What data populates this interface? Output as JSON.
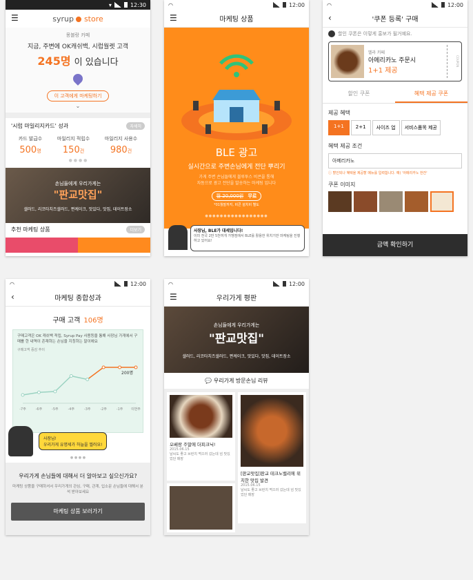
{
  "status": {
    "time": "12:30",
    "time2": "12:00"
  },
  "p1": {
    "logo_syrup": "syrup",
    "logo_store": "store",
    "cafe_name": "몽블랑 카페",
    "hero_line1": "지금, 주변에 OK캐쉬백, 시럽월렛 고객",
    "hero_count": "245명",
    "hero_suffix": "이 있습니다",
    "locate_button": "이 고객에게 마케팅하기",
    "card_title": "'시럽 마일리지카드' 성과",
    "card_badge": "자세히",
    "stats": [
      {
        "label": "카드 발급수",
        "value": "500",
        "unit": "명"
      },
      {
        "label": "마일리지 적립수",
        "value": "150",
        "unit": "건"
      },
      {
        "label": "마일리지 사용수",
        "value": "980",
        "unit": "건"
      }
    ],
    "banner_small": "손님들에게 우리가게는",
    "banner_big": "\"판교맛집\"",
    "banner_tags": "샐러드, 리코타치즈샐러드, 편케이크, 맛있다, 맛집, 데이트장소",
    "rec_title": "추천 마케팅 상품",
    "rec_badge": "더보기"
  },
  "p2": {
    "title": "마케팅 상품",
    "heading": "BLE 광고",
    "sub": "실시간으로 주변손님에게 전단 뿌리기",
    "desc1": "가게 주변 손님들에게 블루투스 비콘을 통해",
    "desc2": "자동으로 광고 전단을 발송하는 마케팅 입니다",
    "price_old": "월 20,000원",
    "price_new": "무료",
    "note": "*01월말까지, 비콘 설치비 별도",
    "tip_title": "사장님, BLE가 대세입니다!",
    "tip_body": "이미 전국 2만 5천여개 가맹점에서 BLE를 활용한 위치기반 마케팅을 진행하고 있어요!"
  },
  "p3": {
    "title": "'쿠폰 등록' 구매",
    "hint": "할인 쿠폰은 이렇게 홍보가 될거예요.",
    "cafe": "벨라 카페",
    "menu": "아메리카노 주문시",
    "offer": "1+1 제공",
    "coupon_side": "COUPON",
    "tab1": "할인 쿠폰",
    "tab2": "혜택 제공 쿠폰",
    "benefit_label": "제공 혜택",
    "chips": [
      "1+1",
      "2+1",
      "사이즈 업",
      "서비스품목 제공"
    ],
    "cond_label": "혜택 제공 조건",
    "cond_value": "아메리카노",
    "cond_hint": "할인되나 혜택을 제공할 메뉴를 입력합니다. 예) '아메리카노 한잔'",
    "image_label": "쿠폰 이미지",
    "confirm": "금액 확인하기"
  },
  "p4": {
    "title": "마케팅 종합성과",
    "headline": "구매 고객",
    "headline_count": "106명",
    "desc": "구매고객은 OK 캐쉬백 적립, Syrup Pay 사용등을 통해 사장님 가게에서 구매를 한 내역이 존재하는 손님을 지칭하는 말이에요",
    "chart_label": "구매고객 증감 추이",
    "last_value": "200명",
    "bubble": "사장님!\n우리가게 유명세가 하늘을 찔러요!",
    "question": "우리가게 손님들에 대해서 더 알아보고 싶으신가요?",
    "answer": "마케팅 상품을 구매하셔서 우리가게의 관심, 구매, 관계, 입소문 손님들에 대해서 분석 받아보세요",
    "cta": "마케팅 상품 보러가기"
  },
  "p5": {
    "title": "우리가게 평판",
    "banner_small": "손님들에게 우리가게는",
    "banner_big": "\"판교맛집\"",
    "banner_tags": "샐러드, 리코타치즈샐러드, 편케이크, 맛있다, 맛집, 데이트장소",
    "review_header": "우리가게 방문손님 리뷰",
    "reviews": [
      {
        "title": "오베랑 주말에 더피크닉!",
        "date": "2015.06.15",
        "body": "날씨도 좋고 브런치 먹으러 갔는데 넘 맛있었던 매장"
      },
      {
        "title": "[판교맛집]판교 테크노밸리에 위치한 맛집 발견",
        "date": "2015.06.15",
        "body": "날씨도 좋고 브런치 먹으러 갔는데 넘 맛있었던 매장"
      }
    ]
  },
  "chart_data": {
    "type": "line",
    "title": "구매고객 증감 추이",
    "categories": [
      "-7주",
      "-6주",
      "-5주",
      "-4주",
      "-3주",
      "-2주",
      "-1주",
      "이번주"
    ],
    "series": [
      {
        "values": [
          40,
          55,
          60,
          150,
          130,
          200,
          200,
          200
        ]
      }
    ],
    "annotation": "200명",
    "colors": {
      "past": "#9ad2c1",
      "recent": "#f47321"
    }
  }
}
